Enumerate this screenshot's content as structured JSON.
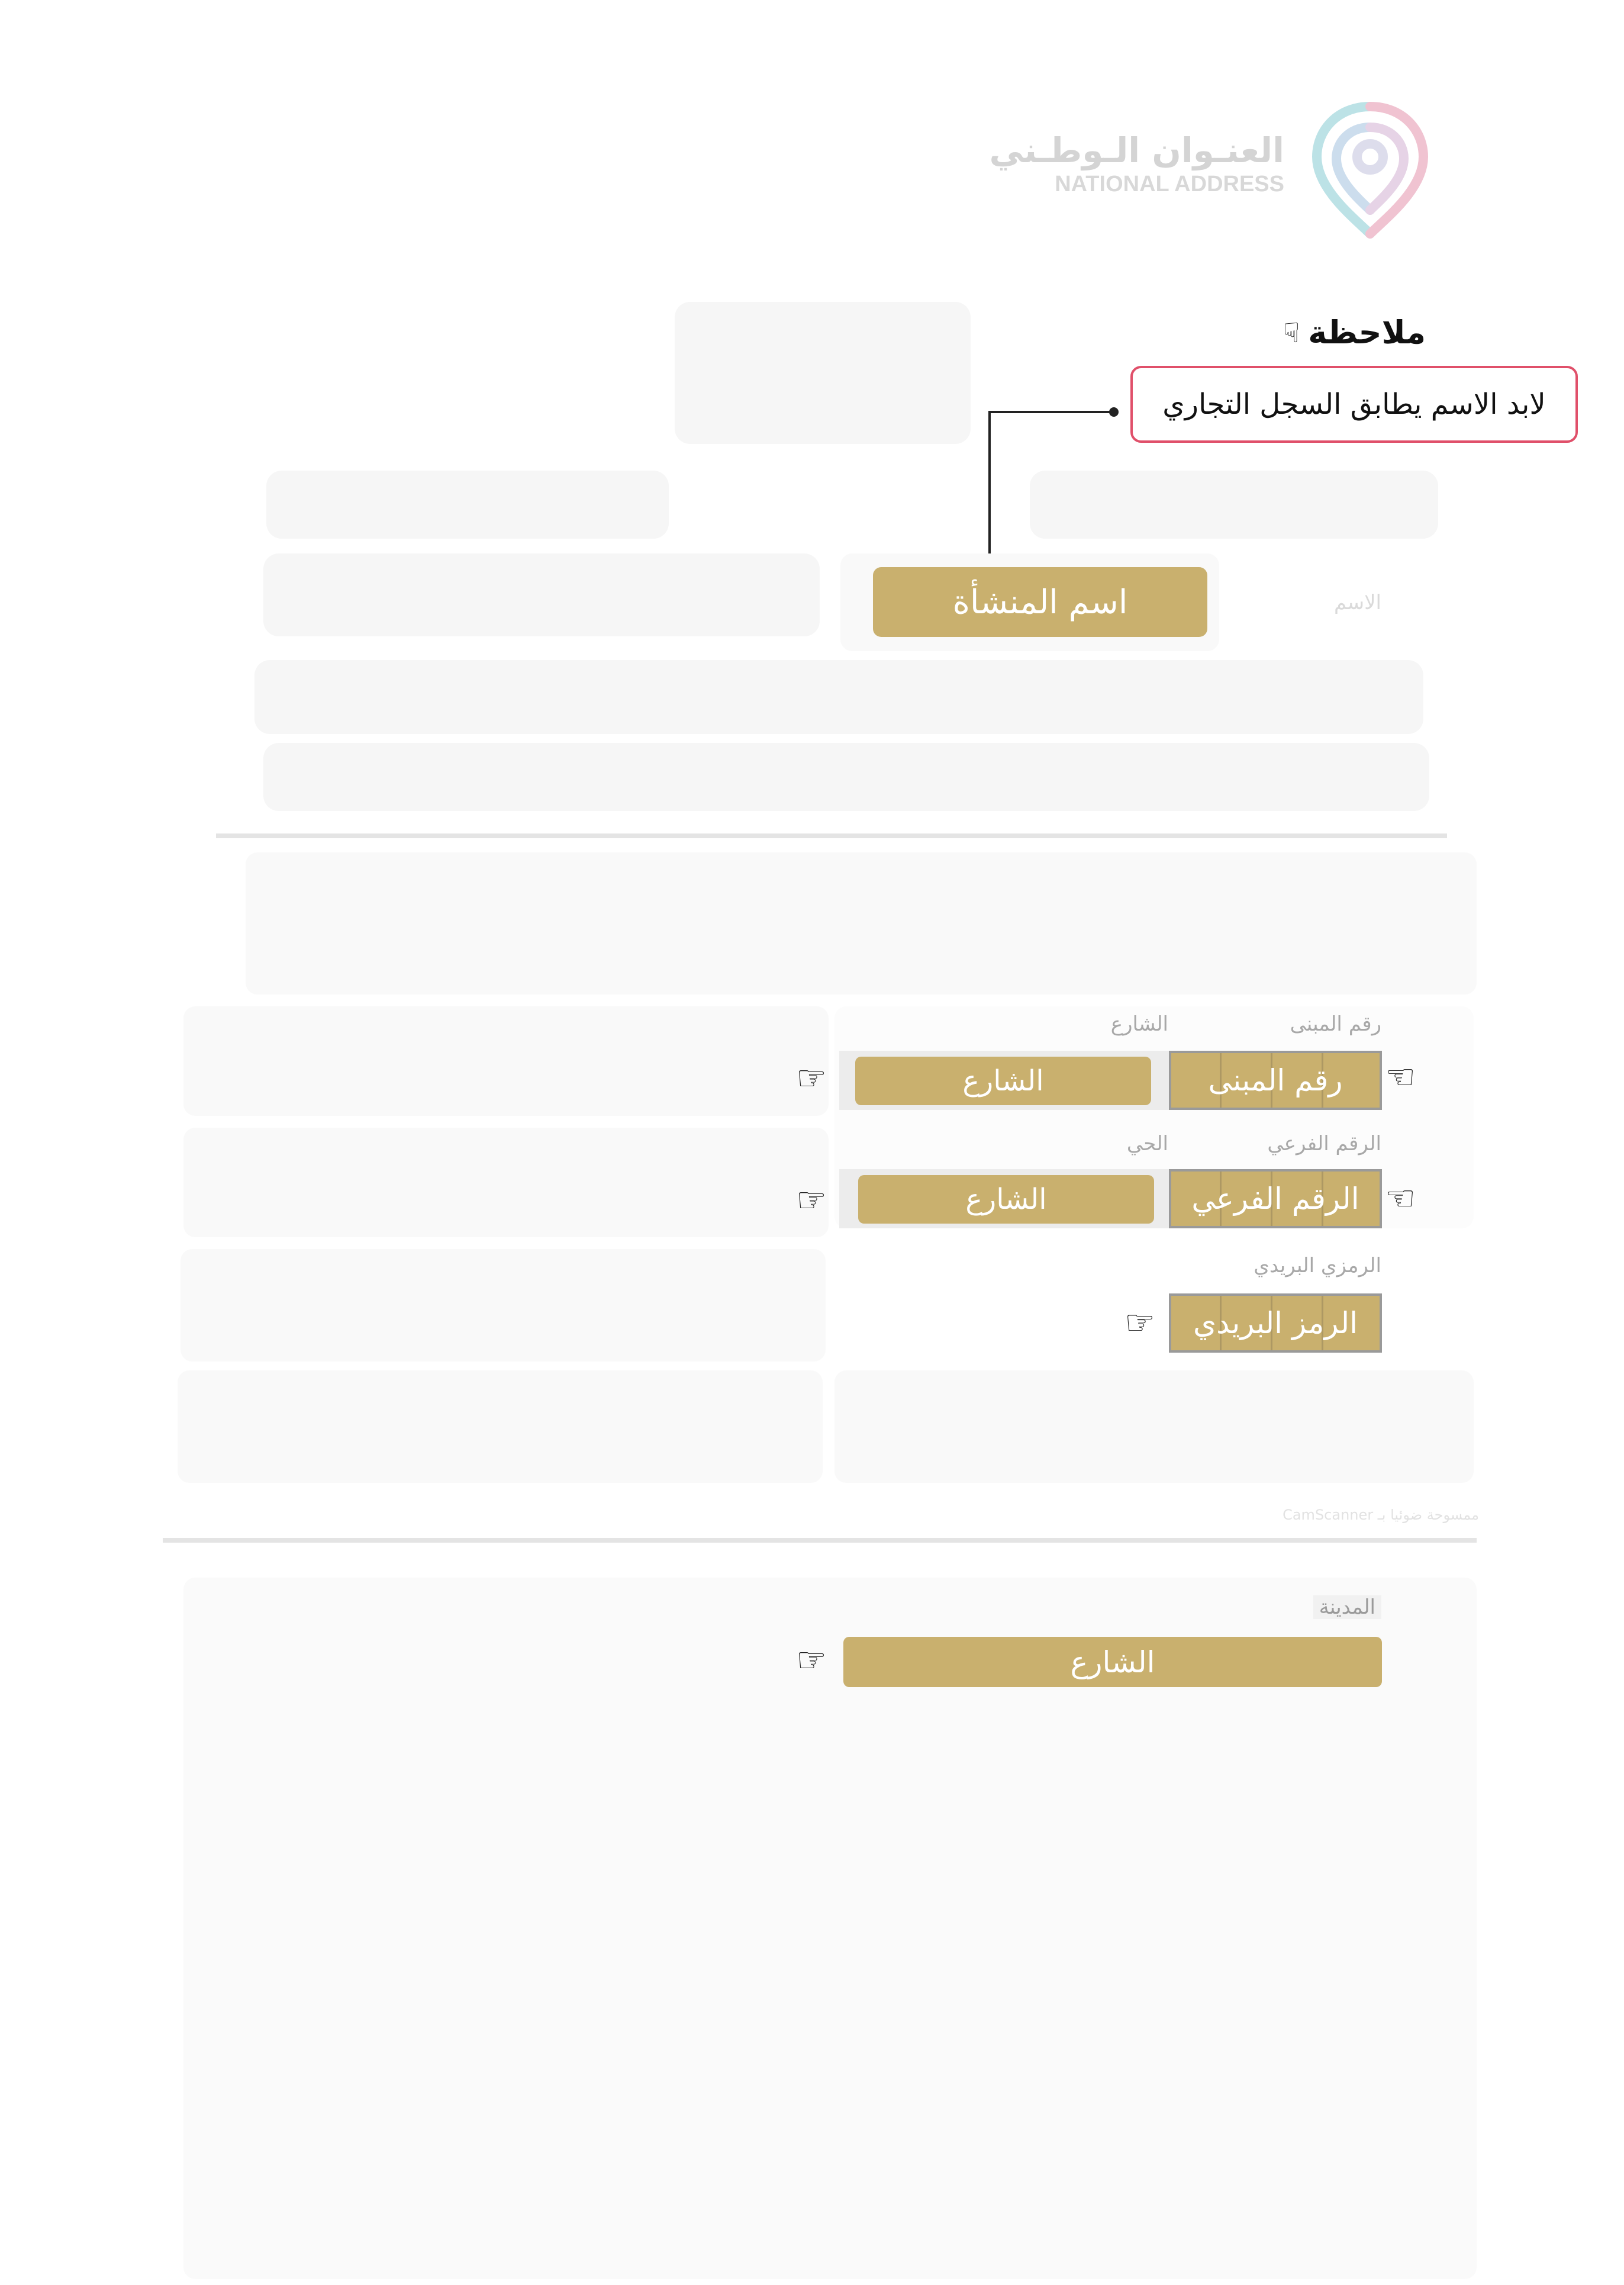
{
  "logo": {
    "arabic": "العنـوان الـوطـني",
    "english": "NATIONAL ADDRESS"
  },
  "note": {
    "title": "ملاحظة",
    "text": "لابد الاسم يطابق السجل التجاري",
    "icon": "pointing-hand-icon"
  },
  "establishment": {
    "label": "اسم المنشأة",
    "faint_label": "الاسم"
  },
  "address": {
    "building_number_label": "رقم المبنى",
    "street_label": "الشارع",
    "building_number_field": "رقم المبنى",
    "street_field": "الشارع",
    "secondary_number_label": "الرقم الفرعي",
    "district_label": "الحي",
    "secondary_number_field": "الرقم الفرعي",
    "district_field": "الشارع",
    "postal_code_label": "الرمزي البريدي",
    "postal_code_field": "الرمز البريدي"
  },
  "scanner_watermark": "ممسوحة ضوئيا بـ CamScanner",
  "city": {
    "label": "المدينة",
    "field": "الشارع"
  },
  "colors": {
    "gold": "#c9b06e",
    "note_border": "#e0506a",
    "rule": "#e4e4e4"
  }
}
